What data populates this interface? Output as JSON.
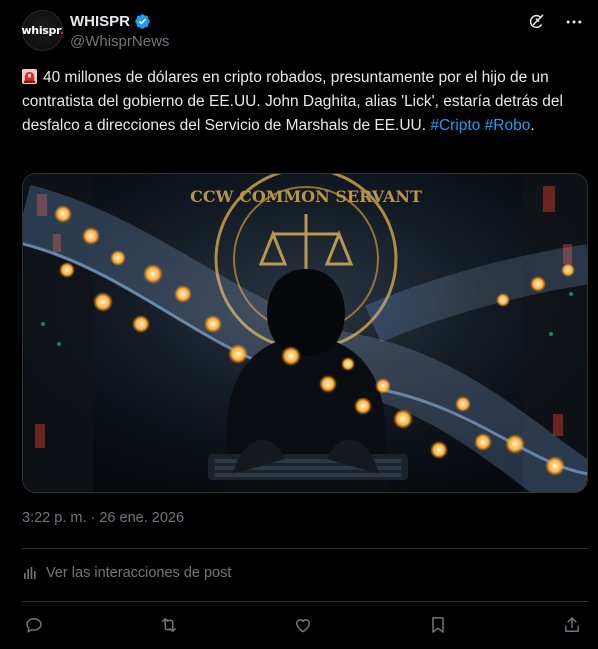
{
  "account": {
    "display_name": "WHISPR",
    "handle": "@WhisprNews",
    "verified": true,
    "avatar_text": "whispr",
    "avatar_dot": "."
  },
  "header_icons": [
    "grok-icon",
    "more-icon"
  ],
  "post": {
    "emoji": "🚨",
    "text": "40 millones de dólares en cripto robados, presuntamente por el hijo de un contratista del gobierno de EE.UU. John Daghita, alias 'Lick', estaría detrás del desfalco a direcciones del Servicio de Marshals de EE.UU. ",
    "hashtags": [
      "#Cripto",
      "#Robo"
    ],
    "hashtag_separator": " ",
    "trailing": "."
  },
  "media": {
    "seal_text": "CCW COMMON SERVANT"
  },
  "timestamp": "3:22 p. m. · 26 ene. 2026",
  "analytics_label": "Ver las interacciones de post",
  "actions": [
    "reply-icon",
    "repost-icon",
    "like-icon",
    "bookmark-icon",
    "share-icon"
  ],
  "colors": {
    "background": "#000000",
    "text": "#e7e9ea",
    "secondary": "#71767b",
    "accent": "#1d9bf0",
    "border": "#2f3336"
  }
}
